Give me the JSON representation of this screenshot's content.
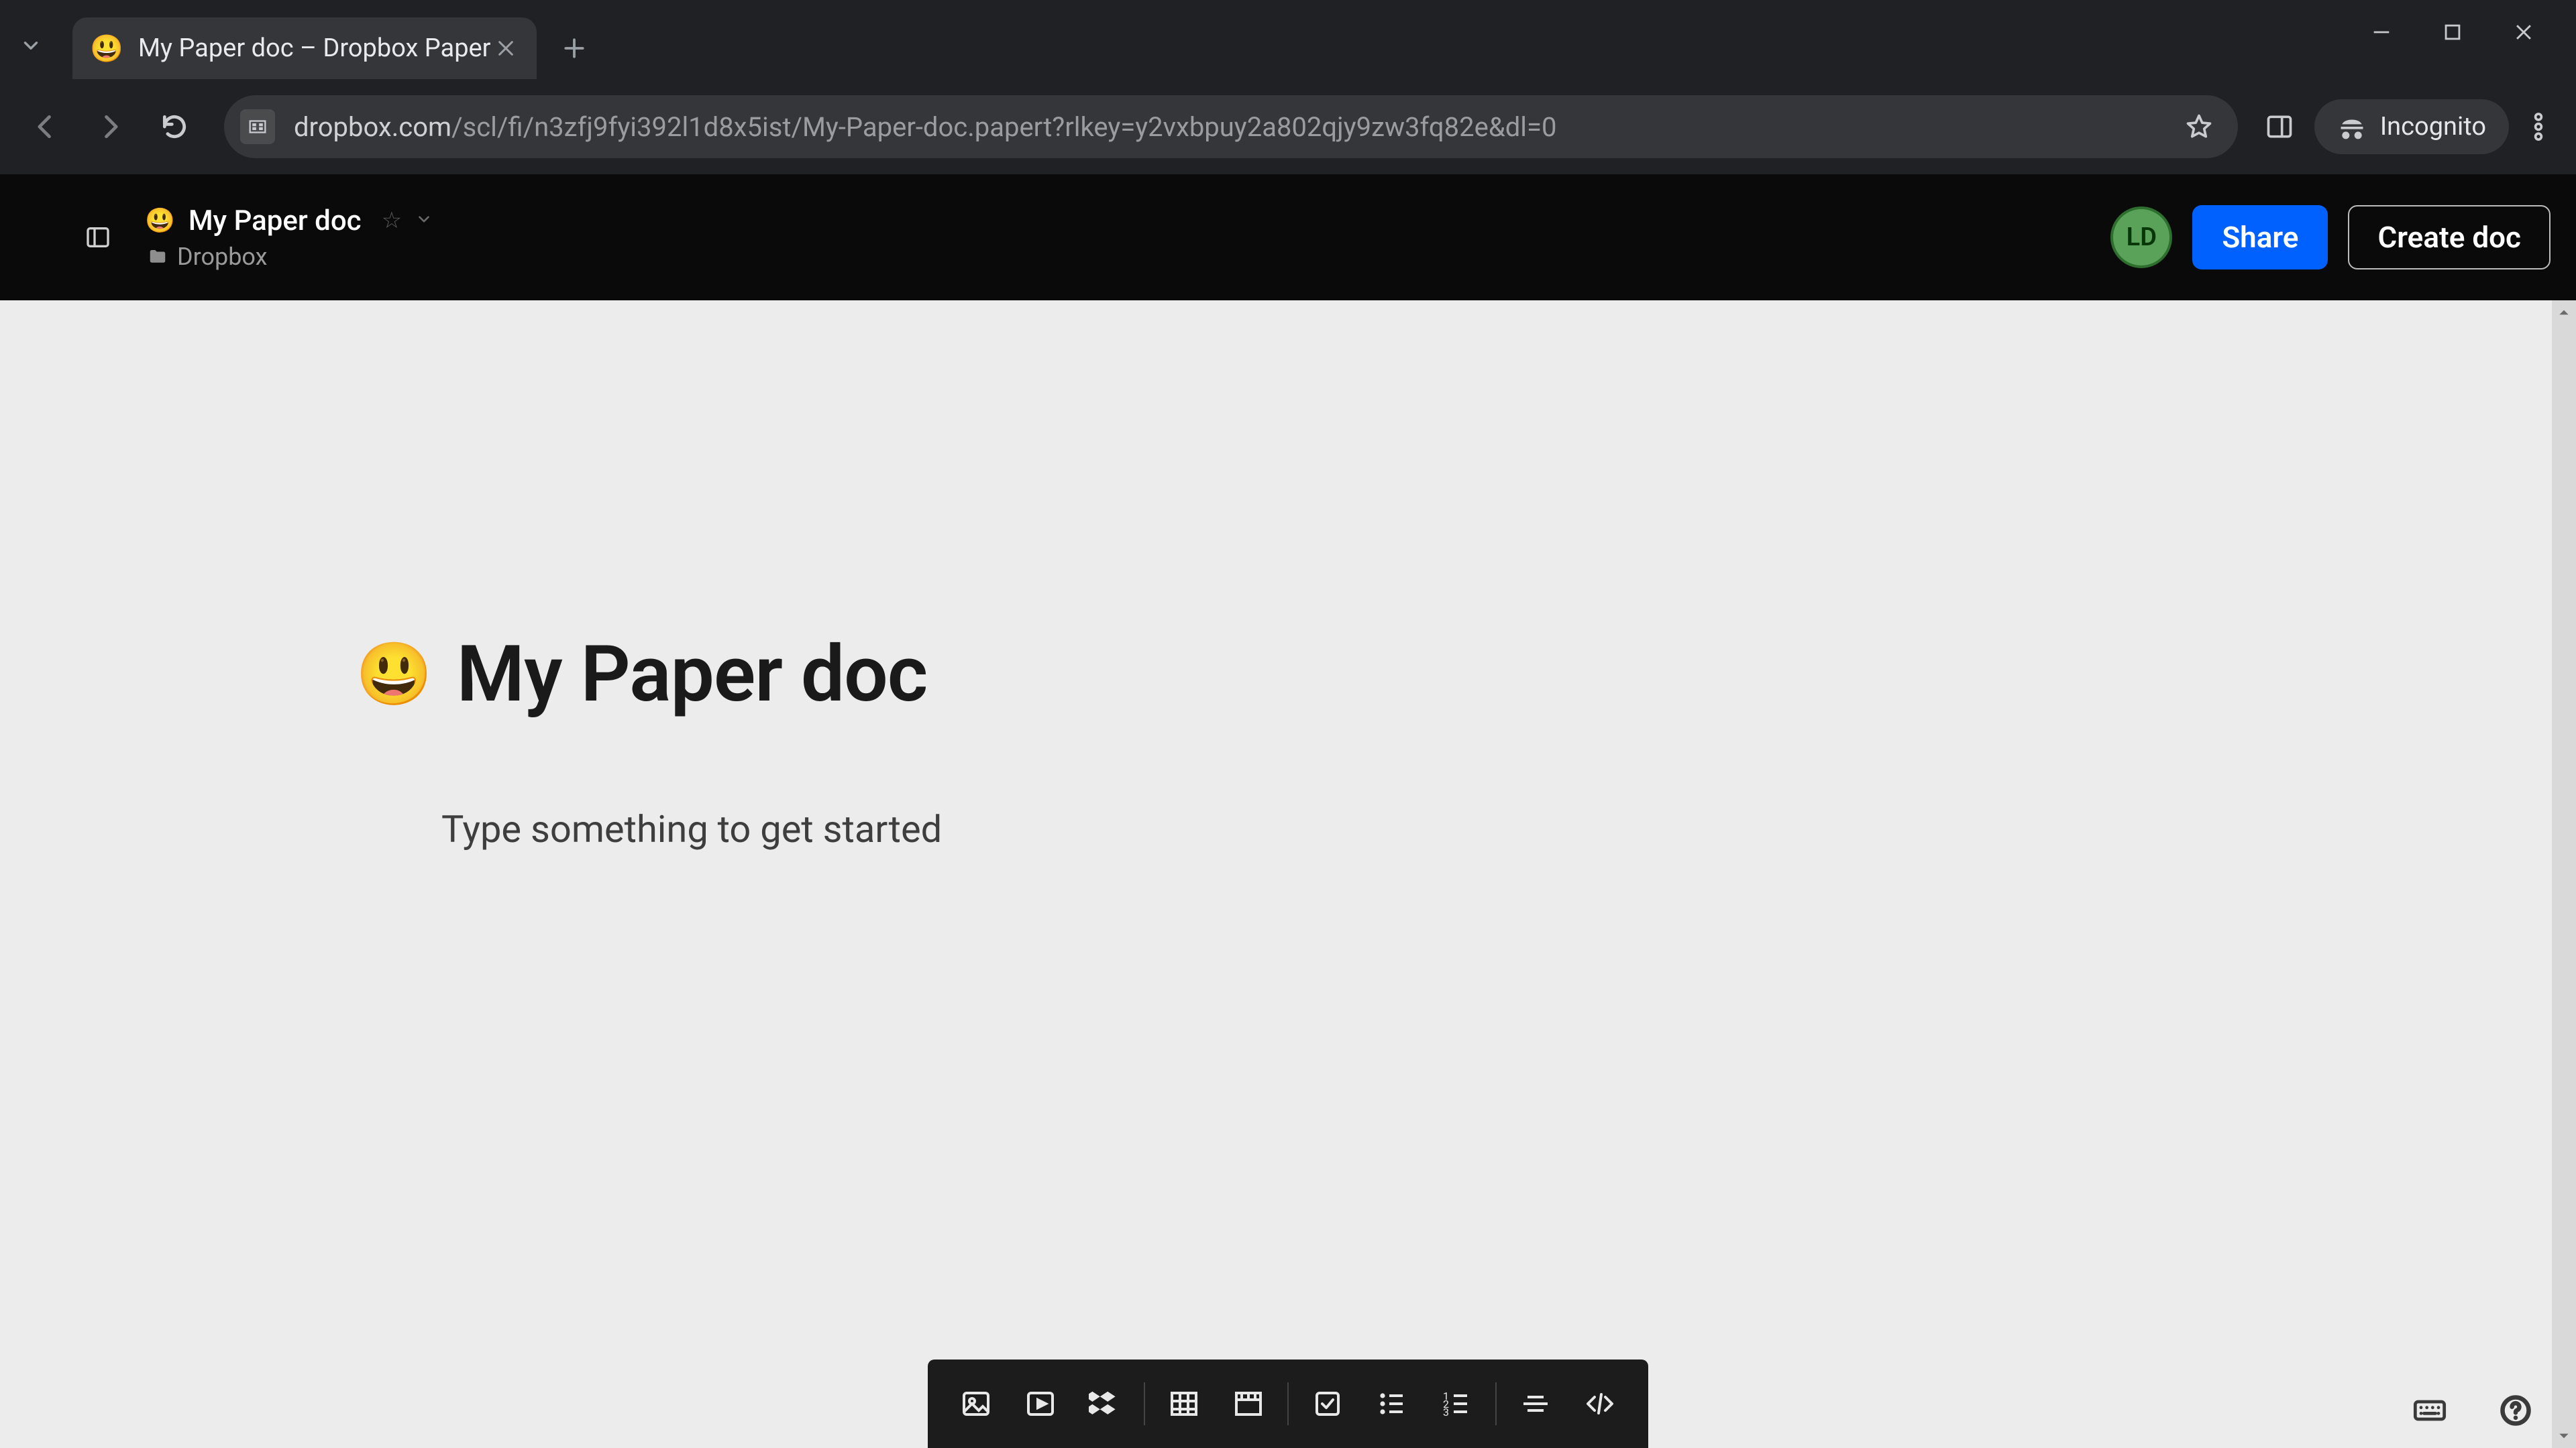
{
  "browser": {
    "tab": {
      "title": "My Paper doc – Dropbox Paper",
      "favicon": "😃"
    },
    "url_host": "dropbox.com",
    "url_path": "/scl/fi/n3zfj9fyi392l1d8x5ist/My-Paper-doc.papert?rlkey=y2vxbpuy2a802qjy9zw3fq82e&dl=0",
    "incognito_label": "Incognito"
  },
  "app_header": {
    "doc_emoji": "😃",
    "doc_title": "My Paper doc",
    "breadcrumb": "Dropbox",
    "avatar_initials": "LD",
    "share_label": "Share",
    "create_label": "Create doc"
  },
  "document": {
    "title_emoji": "😃",
    "title": "My Paper doc",
    "placeholder": "Type something to get started"
  },
  "insert_toolbar": {
    "items": [
      "image",
      "video",
      "dropbox",
      "table",
      "timeline",
      "checkbox",
      "bullet-list",
      "ordered-list",
      "divider",
      "code"
    ]
  }
}
